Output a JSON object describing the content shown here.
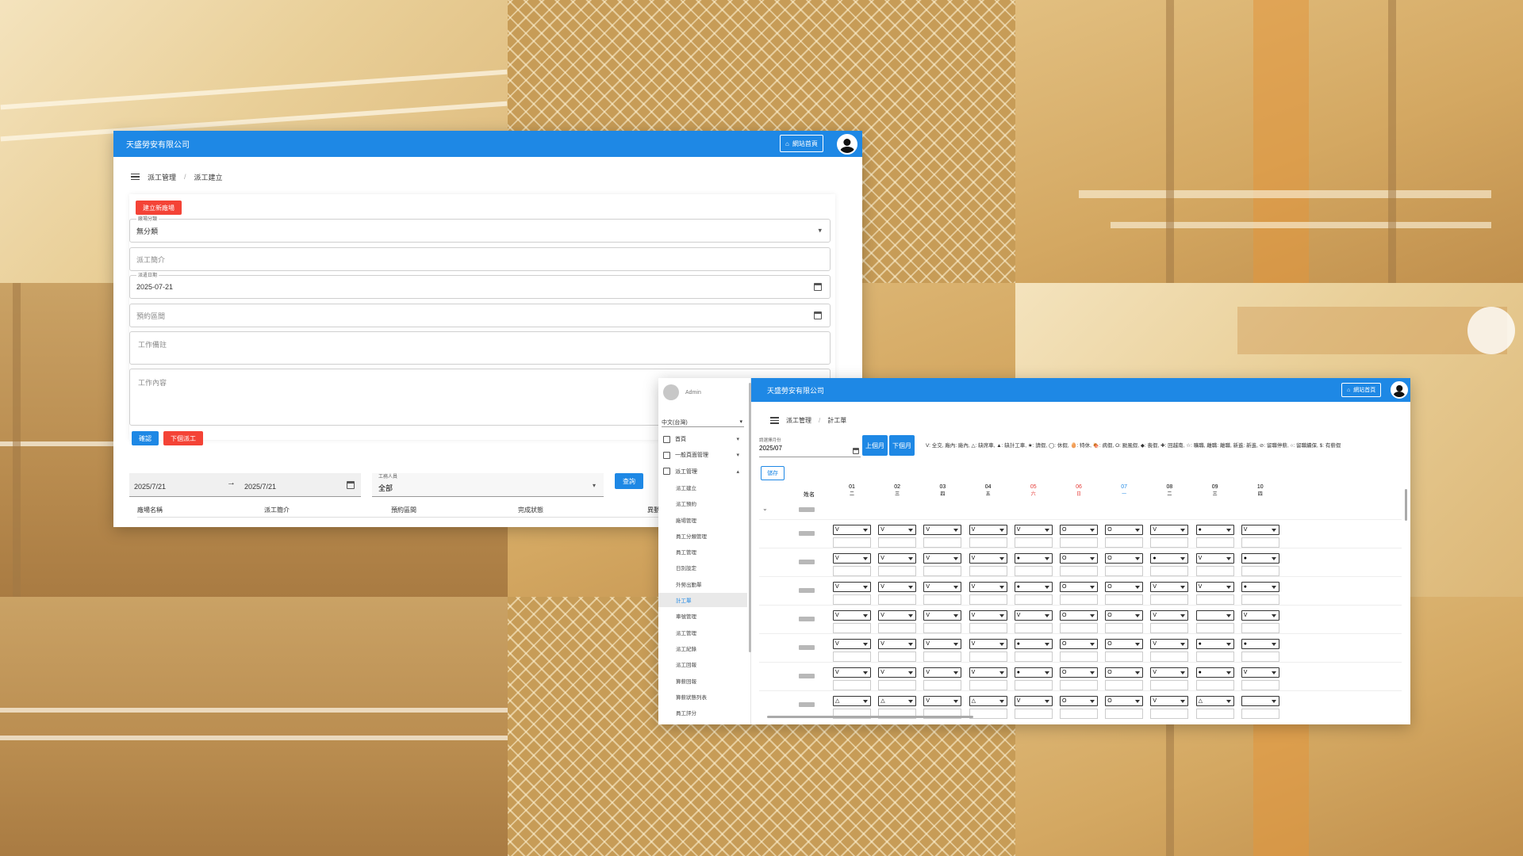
{
  "window1": {
    "brand": "天盛勞安有限公司",
    "home_label": "網站首頁",
    "breadcrumb": [
      "派工管理",
      "派工建立"
    ],
    "create_site_label": "建立新廠場",
    "category_label": "廠場分類",
    "category_value": "無分類",
    "intro_placeholder": "派工簡介",
    "date_label": "派遣日期",
    "date_value": "2025-07-21",
    "period_placeholder": "預約區間",
    "note_placeholder": "工作備註",
    "content_placeholder": "工作內容",
    "confirm_label": "確認",
    "dispatch_label": "下個派工",
    "filter_from": "2025/7/21",
    "filter_arrow": "→",
    "filter_to": "2025/7/21",
    "worker_label": "工務人員",
    "worker_value": "全部",
    "query_label": "查詢",
    "table_headers": [
      "廠場名稱",
      "派工簡介",
      "預約區間",
      "完成狀態",
      "異動"
    ]
  },
  "window2": {
    "user": "Admin",
    "language": "中文(台灣)",
    "menu": [
      {
        "label": "首頁",
        "sub": false
      },
      {
        "label": "一般頁面管理",
        "sub": false
      },
      {
        "label": "派工管理",
        "sub": false
      },
      {
        "label": "派工建立",
        "sub": true
      },
      {
        "label": "派工預約",
        "sub": true
      },
      {
        "label": "廠場管理",
        "sub": true
      },
      {
        "label": "員工分類管理",
        "sub": true
      },
      {
        "label": "員工管理",
        "sub": true
      },
      {
        "label": "日別設定",
        "sub": true
      },
      {
        "label": "外勞出勤單",
        "sub": true
      },
      {
        "label": "計工單",
        "sub": true,
        "active": true
      },
      {
        "label": "車號管理",
        "sub": true
      },
      {
        "label": "派工管理",
        "sub": true
      },
      {
        "label": "派工紀錄",
        "sub": true
      },
      {
        "label": "派工回報",
        "sub": true
      },
      {
        "label": "算薪回報",
        "sub": true
      },
      {
        "label": "算薪狀態列表",
        "sub": true
      },
      {
        "label": "員工評分",
        "sub": true
      }
    ],
    "brand": "天盛勞安有限公司",
    "home_label": "網站首頁",
    "breadcrumb": [
      "派工管理",
      "計工單"
    ],
    "month_label": "請選擇月份",
    "month_value": "2025/07",
    "prev_label": "上個月",
    "next_label": "下個月",
    "legend": "V: 全交, 廠內: 廠內, △: 缺席車, ▲: 缺計工車, ★: 請假, ◯: 休假, 🥚: 特休, 🍖: 病假, O: 颱風假, ◆: 喪假, ✚: 回越南, ☆: 曠職, 離職: 離職, 新進: 新進, ⊘: 留職停薪, ○: 留職續保, $: 有薪假",
    "save_label": "儲存",
    "name_header": "姓名",
    "days": [
      {
        "d": "01",
        "w": "二",
        "c": ""
      },
      {
        "d": "02",
        "w": "三",
        "c": ""
      },
      {
        "d": "03",
        "w": "四",
        "c": ""
      },
      {
        "d": "04",
        "w": "五",
        "c": ""
      },
      {
        "d": "05",
        "w": "六",
        "c": "red"
      },
      {
        "d": "06",
        "w": "日",
        "c": "red"
      },
      {
        "d": "07",
        "w": "一",
        "c": "blue"
      },
      {
        "d": "08",
        "w": "二",
        "c": ""
      },
      {
        "d": "09",
        "w": "三",
        "c": ""
      },
      {
        "d": "10",
        "w": "四",
        "c": ""
      }
    ],
    "rows": [
      [
        "V",
        "V",
        "V",
        "V",
        "V",
        "O",
        "O",
        "V",
        "●",
        "V"
      ],
      [
        "V",
        "V",
        "V",
        "V",
        "●",
        "O",
        "O",
        "●",
        "V",
        "●"
      ],
      [
        "V",
        "V",
        "V",
        "V",
        "●",
        "O",
        "O",
        "V",
        "V",
        "●"
      ],
      [
        "V",
        "V",
        "V",
        "V",
        "V",
        "O",
        "O",
        "V",
        "",
        "V"
      ],
      [
        "V",
        "V",
        "V",
        "V",
        "●",
        "O",
        "O",
        "V",
        "●",
        "●"
      ],
      [
        "V",
        "V",
        "V",
        "V",
        "●",
        "O",
        "O",
        "V",
        "●",
        "V"
      ],
      [
        "△",
        "△",
        "V",
        "△",
        "V",
        "O",
        "O",
        "V",
        "△",
        ""
      ]
    ]
  }
}
